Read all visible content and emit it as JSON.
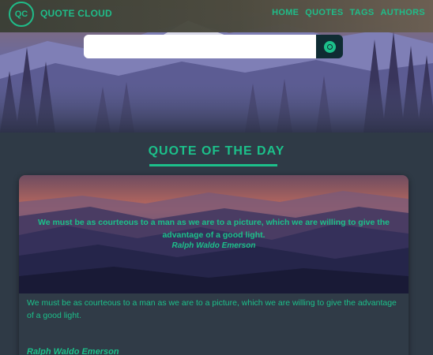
{
  "app": {
    "brand": "QUOTE CLOUD",
    "logo_text": "QC"
  },
  "nav": {
    "items": [
      "HOME",
      "QUOTES",
      "TAGS",
      "AUTHORS"
    ]
  },
  "search": {
    "value": "",
    "placeholder": ""
  },
  "section": {
    "title": "QUOTE OF THE DAY"
  },
  "quote": {
    "text": "We must be as courteous to a man as we are to a picture, which we are willing to give the advantage of a good light.",
    "author": "Ralph Waldo Emerson"
  },
  "colors": {
    "accent": "#1cc08a",
    "page_bg": "#2f3a46",
    "search_button": "#0f2c33"
  },
  "icons": {
    "search": "search-icon",
    "logo": "cloud-logo-icon"
  }
}
